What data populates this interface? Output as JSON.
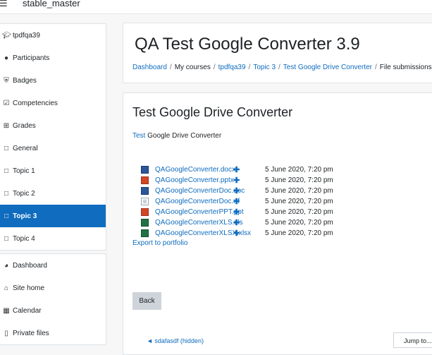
{
  "topbar": {
    "menu_icon": "hamburger-icon",
    "site_name": "stable_master"
  },
  "sidebar": {
    "groups": [
      [
        {
          "label": "tpdfqa39",
          "icon": "graduation-cap-icon"
        },
        {
          "label": "Participants",
          "icon": "users-icon"
        },
        {
          "label": "Badges",
          "icon": "shield-icon"
        },
        {
          "label": "Competencies",
          "icon": "check-square-icon"
        },
        {
          "label": "Grades",
          "icon": "table-icon"
        },
        {
          "label": "General",
          "icon": "folder-icon"
        },
        {
          "label": "Topic 1",
          "icon": "folder-icon"
        },
        {
          "label": "Topic 2",
          "icon": "folder-icon"
        },
        {
          "label": "Topic 3",
          "icon": "folder-icon",
          "active": true
        },
        {
          "label": "Topic 4",
          "icon": "folder-icon"
        }
      ],
      [
        {
          "label": "Dashboard",
          "icon": "tachometer-icon"
        },
        {
          "label": "Site home",
          "icon": "home-icon"
        },
        {
          "label": "Calendar",
          "icon": "calendar-icon"
        },
        {
          "label": "Private files",
          "icon": "file-icon"
        }
      ]
    ]
  },
  "header": {
    "course_title": "QA Test Google Converter 3.9",
    "breadcrumb": [
      "Dashboard",
      "My courses",
      "tpdfqa39",
      "Topic 3",
      "Test Google Drive Converter",
      "File submissions"
    ]
  },
  "main": {
    "title": "Test Google Drive Converter",
    "intro_link": "Test",
    "intro_rest": " Google Drive Converter",
    "files": [
      {
        "name": "QAGoogleConverter.docx",
        "type": "docx",
        "date": "5 June 2020, 7:20 pm"
      },
      {
        "name": "QAGoogleConverter.pptx",
        "type": "pptx",
        "date": "5 June 2020, 7:20 pm"
      },
      {
        "name": "QAGoogleConverterDoc.doc",
        "type": "docx",
        "date": "5 June 2020, 7:20 pm"
      },
      {
        "name": "QAGoogleConverterDoc.rtf",
        "type": "rtf",
        "date": "5 June 2020, 7:20 pm"
      },
      {
        "name": "QAGoogleConverterPPT.ppt",
        "type": "pptx",
        "date": "5 June 2020, 7:20 pm"
      },
      {
        "name": "QAGoogleConverterXLS.xls",
        "type": "xls",
        "date": "5 June 2020, 7:20 pm"
      },
      {
        "name": "QAGoogleConverterXLSX.xlsx",
        "type": "xls",
        "date": "5 June 2020, 7:20 pm"
      }
    ],
    "add_icon": "plus-icon",
    "export_label": "Export to portfolio",
    "back_label": "Back",
    "prev_activity": "◄ sdafasdf (hidden)",
    "jump_to": "Jump to..."
  },
  "colors": {
    "accent": "#0f6cbf",
    "active_bg": "#0f6cbf",
    "page_bg": "#f7f7f7"
  }
}
